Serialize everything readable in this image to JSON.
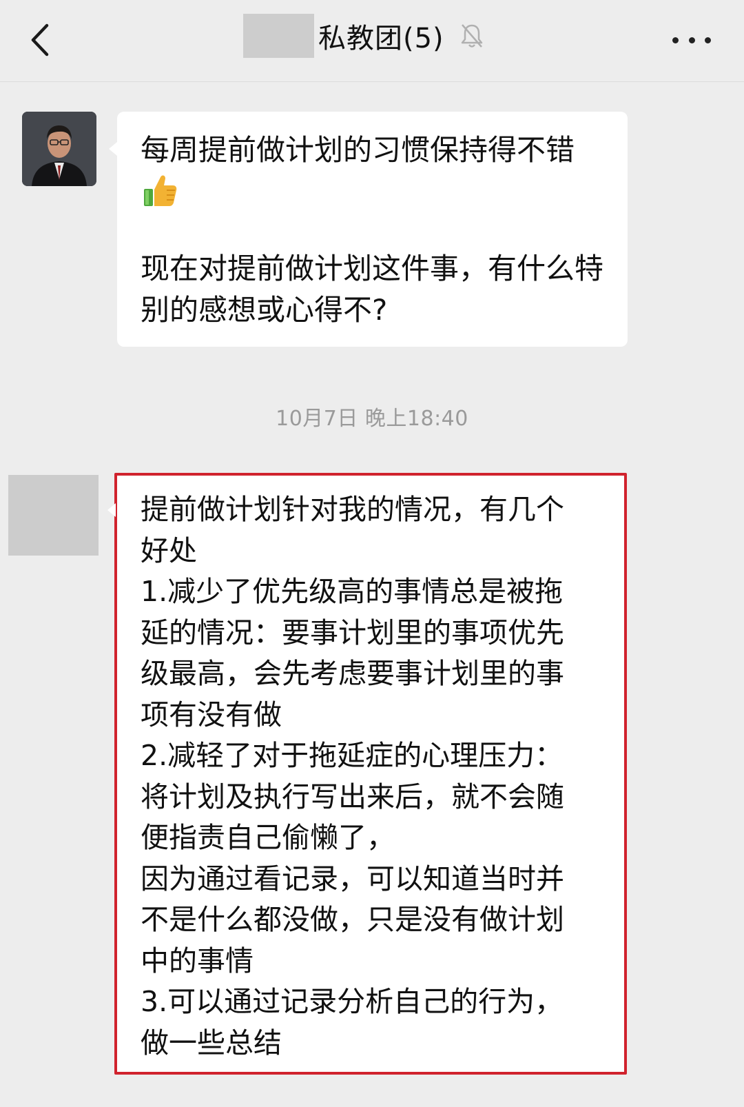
{
  "header": {
    "title": "私教团(5)",
    "back_icon": "chevron-left-icon",
    "mute_icon": "bell-off-icon",
    "more_icon": "more-dots-icon"
  },
  "messages": [
    {
      "line1": "每周提前做计划的习惯保持得不错",
      "emoji": "thumbs-up-icon",
      "line2": "现在对提前做计划这件事，有什么特别的感想或心得不?"
    }
  ],
  "timestamp": "10月7日 晚上18:40",
  "reply": {
    "lines": [
      "提前做计划针对我的情况，有几个",
      "好处",
      "1.减少了优先级高的事情总是被拖",
      "延的情况：要事计划里的事项优先",
      "级最高，会先考虑要事计划里的事",
      "项有没有做",
      "2.减轻了对于拖延症的心理压力：",
      "将计划及执行写出来后，就不会随",
      "便指责自己偷懒了，",
      "因为通过看记录，可以知道当时并",
      "不是什么都没做，只是没有做计划",
      "中的事情",
      "3.可以通过记录分析自己的行为，",
      "做一些总结"
    ],
    "highlight_color": "#d0222d"
  }
}
